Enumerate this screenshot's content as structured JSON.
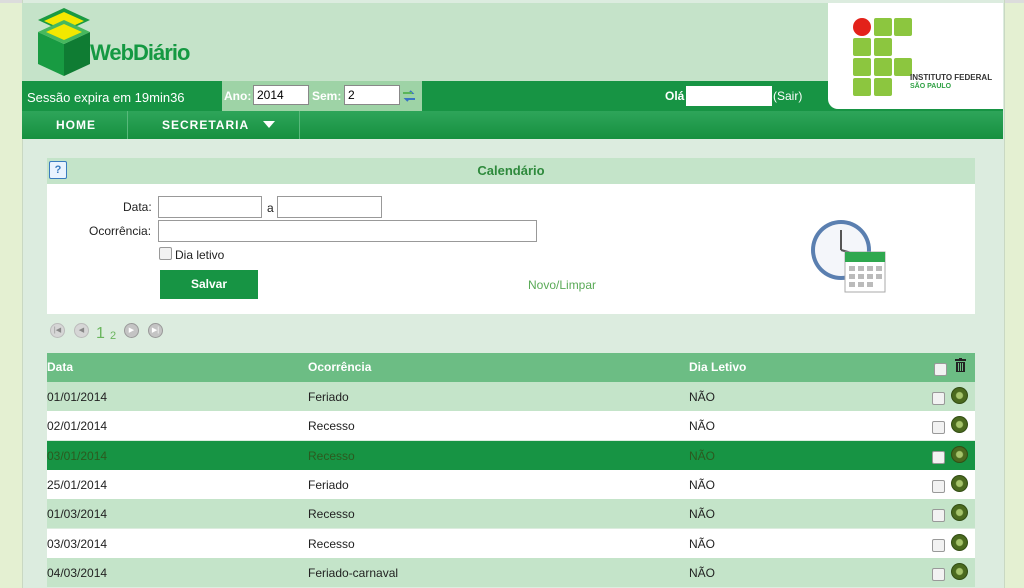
{
  "app": {
    "name": "WebDiário"
  },
  "institution": {
    "line1": "INSTITUTO FEDERAL",
    "line2": "SÃO PAULO"
  },
  "session": {
    "text": "Sessão expira em 19min36"
  },
  "period": {
    "year_label": "Ano:",
    "year_value": "2014",
    "sem_label": "Sem:",
    "sem_value": "2"
  },
  "user": {
    "greeting": "Olá",
    "logout": "(Sair)"
  },
  "nav": {
    "home": "HOME",
    "secretaria": "SECRETARIA"
  },
  "form": {
    "title": "Calendário",
    "help": "?",
    "data_label": "Data:",
    "a_label": "a",
    "ocorrencia_label": "Ocorrência:",
    "dia_letivo_label": "Dia letivo",
    "save": "Salvar",
    "new_clear": "Novo/Limpar"
  },
  "pager": {
    "page1": "1",
    "page2": "2"
  },
  "table": {
    "headers": [
      "Data",
      "Ocorrência",
      "Dia Letivo"
    ],
    "rows": [
      [
        "01/01/2014",
        "Feriado",
        "NÃO"
      ],
      [
        "02/01/2014",
        "Recesso",
        "NÃO"
      ],
      [
        "03/01/2014",
        "Recesso",
        "NÃO"
      ],
      [
        "25/01/2014",
        "Feriado",
        "NÃO"
      ],
      [
        "01/03/2014",
        "Recesso",
        "NÃO"
      ],
      [
        "03/03/2014",
        "Recesso",
        "NÃO"
      ],
      [
        "04/03/2014",
        "Feriado-carnaval",
        "NÃO"
      ]
    ]
  },
  "colors": {
    "primary": "#179444",
    "header_bg": "#c5e3c9",
    "row_alt": "#c4e4c9",
    "row_selected": "#179444"
  }
}
